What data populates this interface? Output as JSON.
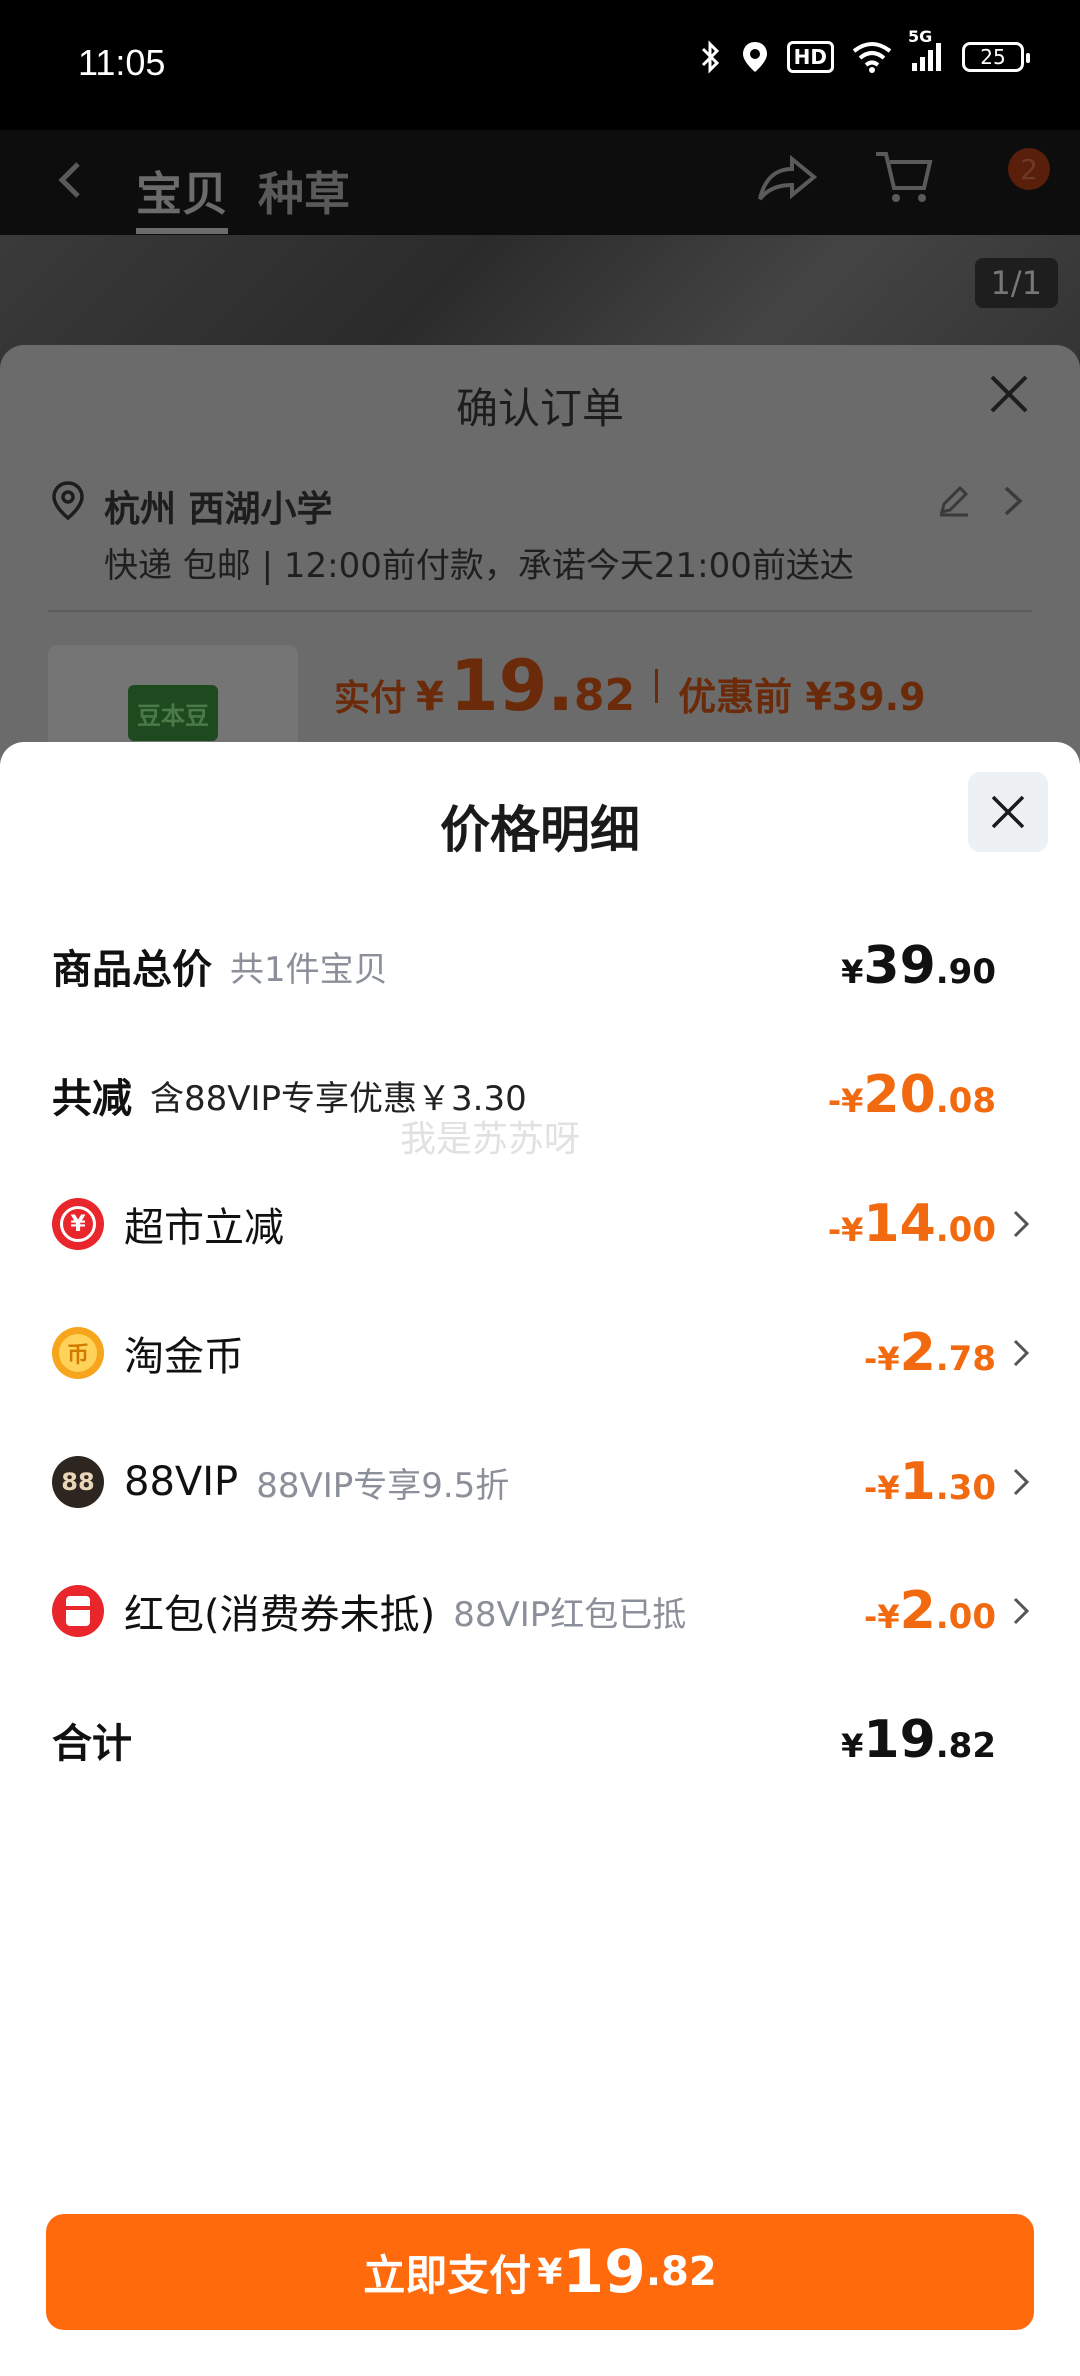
{
  "status_bar": {
    "time": "11:05",
    "network": "5G",
    "battery": "25",
    "hd": "HD"
  },
  "background_page": {
    "tabs": [
      "宝贝",
      "种草"
    ],
    "cart_badge": "2",
    "image_pager": "1/1"
  },
  "order_sheet": {
    "title": "确认订单",
    "address_name": "杭州 西湖小学",
    "address_detail": "快递 包邮 | 12:00前付款，承诺今天21:00前送达",
    "product_logo": "豆本豆",
    "paid_label": "实付",
    "paid_yen": "¥",
    "paid_int": "19.",
    "paid_dec": "82",
    "pre_discount": "优惠前 ¥39.9"
  },
  "price_detail": {
    "title": "价格明细",
    "rows": [
      {
        "label": "商品总价",
        "sub": "共1件宝贝",
        "yen": "¥",
        "int": "39",
        "dec": ".90"
      },
      {
        "label": "共减",
        "sub": "含88VIP专享优惠￥3.30",
        "yen": "-¥",
        "int": "20",
        "dec": ".08"
      },
      {
        "label": "超市立减",
        "sub": "",
        "yen": "-¥",
        "int": "14",
        "dec": ".00"
      },
      {
        "label": "淘金币",
        "sub": "",
        "yen": "-¥",
        "int": "2",
        "dec": ".78"
      },
      {
        "label": "88VIP",
        "sub": "88VIP专享9.5折",
        "yen": "-¥",
        "int": "1",
        "dec": ".30"
      },
      {
        "label": "红包(消费券未抵)",
        "sub": "88VIP红包已抵",
        "yen": "-¥",
        "int": "2",
        "dec": ".00"
      },
      {
        "label": "合计",
        "sub": "",
        "yen": "¥",
        "int": "19",
        "dec": ".82"
      }
    ],
    "icons": {
      "supermarket": "¥",
      "coin": "币",
      "vip": "88"
    },
    "watermark": "我是苏苏呀"
  },
  "pay_button": {
    "label": "立即支付",
    "yen": "¥",
    "int": "19",
    "dec": ".82"
  },
  "colors": {
    "accent": "#ff6a0c",
    "discount": "#f26a10",
    "text": "#111111",
    "muted": "#8a8f99"
  }
}
